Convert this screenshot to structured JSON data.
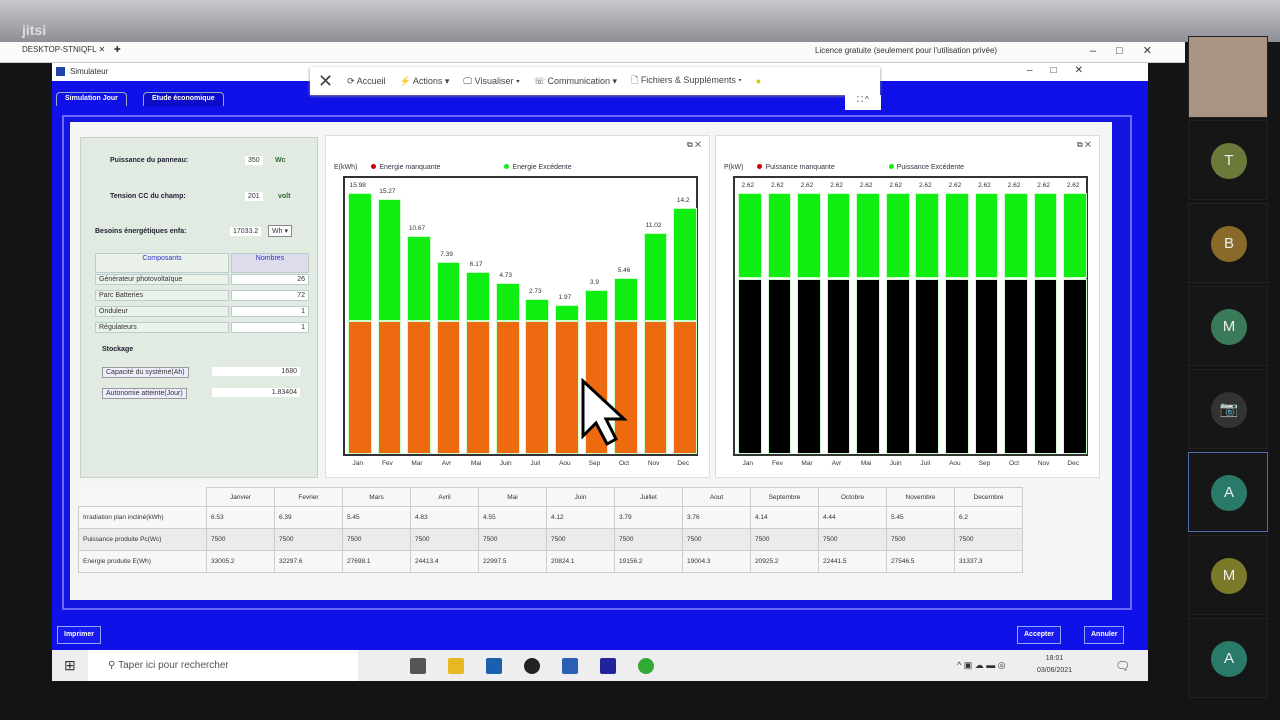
{
  "meeting": {
    "app": "jitsi",
    "participants": [
      {
        "initial": "T",
        "color": "#6b7a3a"
      },
      {
        "initial": "B",
        "color": "#8a6a2a"
      },
      {
        "initial": "M",
        "color": "#3a7a5a"
      },
      {
        "initial": "",
        "color": "#333"
      },
      {
        "initial": "A",
        "color": "#2a7a6a"
      },
      {
        "initial": "M",
        "color": "#7a7a2a"
      },
      {
        "initial": "A",
        "color": "#2a7a6a"
      }
    ]
  },
  "remote": {
    "tab": "DESKTOP-STNIQFL",
    "license": "Licence gratuite (seulement pour l'utilisation privée)"
  },
  "toolbar": {
    "accueil": "Accueil",
    "actions": "Actions ▾",
    "visualiser": "Visualiser ▾",
    "communication": "Communication ▾",
    "fichiers": "Fichiers & Suppléments ▾"
  },
  "window": {
    "title": "Simulateur",
    "tabs": [
      "Simulation Jour",
      "Etude économique"
    ]
  },
  "form": {
    "puissance_label": "Puissance du panneau:",
    "puissance_value": "350",
    "puissance_unit": "Wc",
    "tension_label": "Tension CC du champ:",
    "tension_value": "201",
    "tension_unit": "volt",
    "besoins_label": "Besoins énergétiques enfa:",
    "besoins_value": "17033.2",
    "besoins_unit": "Wh",
    "components_header": "Composants",
    "numbers_header": "Nombres",
    "components": [
      {
        "name": "Générateur photovoltaïque",
        "n": "26"
      },
      {
        "name": "Parc Batteries",
        "n": "72"
      },
      {
        "name": "Onduleur",
        "n": "1"
      },
      {
        "name": "Régulateurs",
        "n": "1"
      }
    ],
    "stockage_label": "Stockage",
    "capacite_label": "Capacité du système(Ah)",
    "capacite_value": "1680",
    "autonomie_label": "Autonomie atteinte(Jour)",
    "autonomie_value": "1.83404"
  },
  "chart_data": [
    {
      "type": "bar",
      "stacked": true,
      "ylabel": "E(kWh)",
      "categories": [
        "Jan",
        "Fev",
        "Mar",
        "Avr",
        "Mai",
        "Juin",
        "Juil",
        "Aou",
        "Sep",
        "Oct",
        "Nov",
        "Dec"
      ],
      "series": [
        {
          "name": "Energie manquante",
          "color": "#ee6a10",
          "values": [
            16.6,
            16.6,
            16.6,
            16.6,
            16.6,
            16.6,
            16.6,
            16.6,
            16.6,
            16.6,
            16.6,
            16.6
          ]
        },
        {
          "name": "Energie Excédente",
          "color": "#11ee11",
          "values": [
            15.98,
            15.27,
            10.67,
            7.39,
            6.17,
            4.73,
            2.73,
            1.97,
            3.9,
            5.46,
            11.02,
            14.2
          ]
        }
      ],
      "labels": [
        "15.98",
        "15.27",
        "10.67",
        "7.39",
        "6.17",
        "4.73",
        "2.73",
        "1.97",
        "3.9",
        "5.46",
        "11.02",
        "14.2"
      ],
      "ylim": [
        0,
        34.5
      ]
    },
    {
      "type": "bar",
      "stacked": true,
      "ylabel": "P(kW)",
      "categories": [
        "Jan",
        "Fev",
        "Mar",
        "Avr",
        "Mai",
        "Juin",
        "Juil",
        "Aou",
        "Sep",
        "Oct",
        "Nov",
        "Dec"
      ],
      "series": [
        {
          "name": "Puissance manquante",
          "color": "#000000",
          "values": [
            5.36,
            5.36,
            5.36,
            5.36,
            5.36,
            5.36,
            5.36,
            5.36,
            5.36,
            5.36,
            5.36,
            5.36
          ]
        },
        {
          "name": "Puissance Excédente",
          "color": "#11ee11",
          "values": [
            2.62,
            2.62,
            2.62,
            2.62,
            2.62,
            2.62,
            2.62,
            2.62,
            2.62,
            2.62,
            2.62,
            2.62
          ]
        }
      ],
      "labels": [
        "2.62",
        "2.62",
        "2.62",
        "2.62",
        "2.62",
        "2.62",
        "2.62",
        "2.62",
        "2.62",
        "2.62",
        "2.62",
        "2.62"
      ],
      "ylim": [
        0,
        8.43
      ]
    }
  ],
  "table": {
    "headers": [
      "Janvier",
      "Fevrier",
      "Mars",
      "Avril",
      "Mai",
      "Juin",
      "Juillet",
      "Aout",
      "Septembre",
      "Octobre",
      "Novembre",
      "Decembre"
    ],
    "rows": [
      {
        "label": "Irradiation plan incliné(kWh)",
        "values": [
          "6.53",
          "6.39",
          "5.45",
          "4.83",
          "4.55",
          "4.12",
          "3.79",
          "3.76",
          "4.14",
          "4.44",
          "5.45",
          "6.2"
        ]
      },
      {
        "label": "Puissance produite Pc(Wc)",
        "values": [
          "7500",
          "7500",
          "7500",
          "7500",
          "7500",
          "7500",
          "7500",
          "7500",
          "7500",
          "7500",
          "7500",
          "7500"
        ]
      },
      {
        "label": "Energie produite E(Wh)",
        "values": [
          "33005.2",
          "32297.6",
          "27698.1",
          "24413.4",
          "22997.5",
          "20824.1",
          "19156.2",
          "19004.3",
          "20925.2",
          "22441.5",
          "27546.5",
          "31337.3"
        ]
      }
    ]
  },
  "buttons": {
    "imprimer": "Imprimer",
    "accepter": "Accepter",
    "annuler": "Annuler"
  },
  "taskbar": {
    "search_placeholder": "Taper ici pour rechercher",
    "time": "18:01",
    "date": "03/06/2021"
  }
}
